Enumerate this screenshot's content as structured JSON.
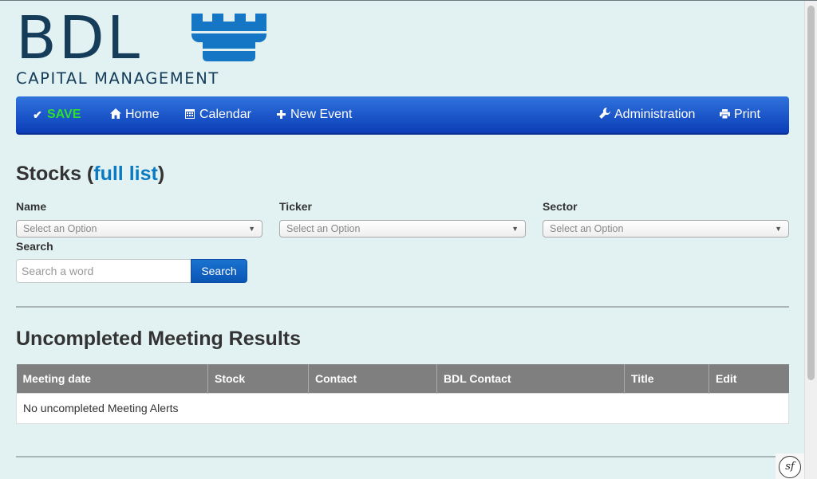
{
  "logo": {
    "main_text": "BDL",
    "sub_text": "CAPITAL MANAGEMENT"
  },
  "navbar": {
    "save": "SAVE",
    "home": "Home",
    "calendar": "Calendar",
    "new_event": "New Event",
    "administration": "Administration",
    "print": "Print"
  },
  "stocks": {
    "title": "Stocks",
    "full_list_link": "full list",
    "name_label": "Name",
    "ticker_label": "Ticker",
    "sector_label": "Sector",
    "select_placeholder": "Select an Option",
    "search_label": "Search",
    "search_placeholder": "Search a word",
    "search_button": "Search"
  },
  "meetings": {
    "title": "Uncompleted Meeting Results",
    "columns": [
      "Meeting date",
      "Stock",
      "Contact",
      "BDL Contact",
      "Title",
      "Edit"
    ],
    "empty_message": "No uncompleted Meeting Alerts"
  },
  "icons": {
    "save": "check-icon",
    "home": "home-icon",
    "calendar": "calendar-icon",
    "new_event": "plus-icon",
    "administration": "wrench-icon",
    "print": "print-icon",
    "debug": "symfony-icon"
  },
  "colors": {
    "background": "#e2f1f2",
    "navbar_top": "#2f73dc",
    "navbar_bottom": "#0b3db8",
    "save_green": "#2ce02c",
    "link_blue": "#0a7ac2",
    "logo_navy": "#153d5a",
    "tower_blue": "#1476c4",
    "table_header": "#7f7f7f"
  },
  "debug_badge": "sf"
}
